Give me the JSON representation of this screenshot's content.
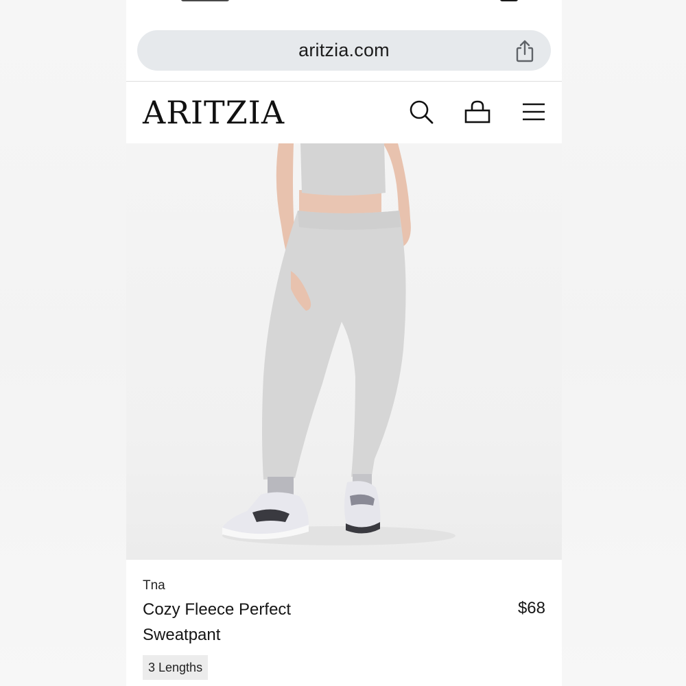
{
  "browser": {
    "url": "aritzia.com",
    "share_icon": "share-icon"
  },
  "header": {
    "logo": "ARITZIA",
    "icons": [
      "search-icon",
      "bag-icon",
      "menu-icon"
    ]
  },
  "product": {
    "brand": "Tna",
    "name": "Cozy Fleece Perfect Sweatpant",
    "price": "$68",
    "lengths_badge": "3 Lengths"
  },
  "colors": {
    "url_bar_bg": "#e6e9ec",
    "text": "#151515",
    "badge_bg": "#ececec",
    "garment": "#d6d6d6"
  }
}
